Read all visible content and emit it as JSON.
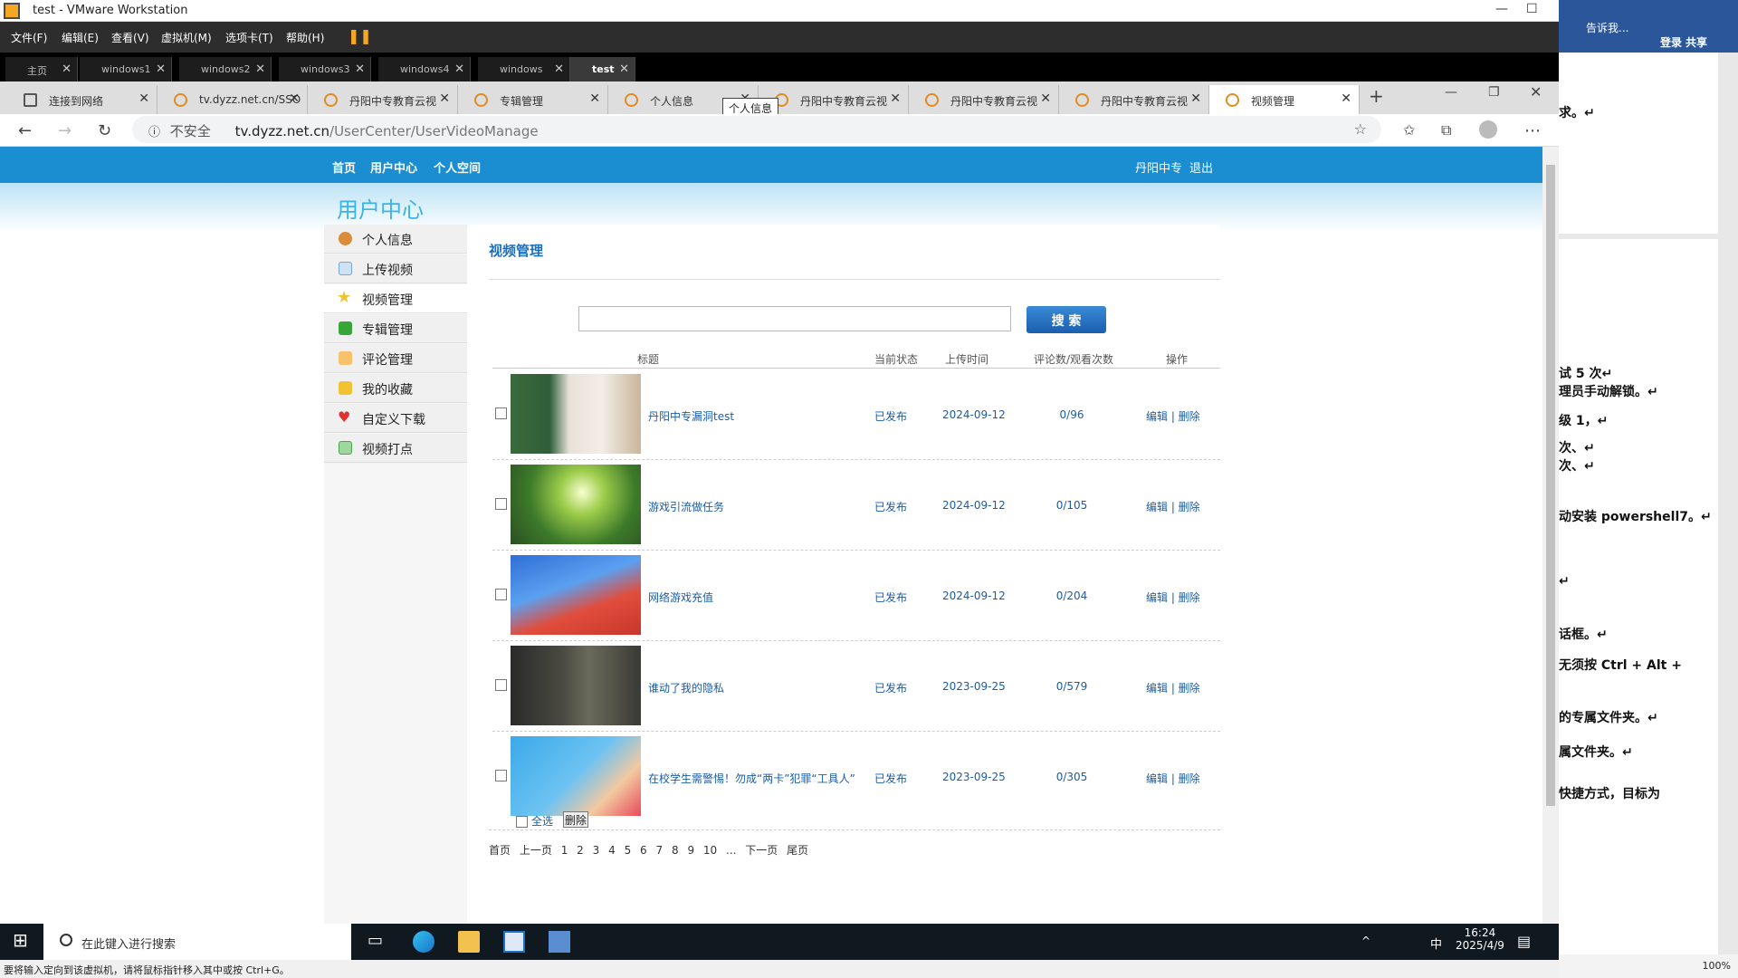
{
  "vmware": {
    "title": "test - VMware Workstation",
    "menu": [
      "文件(F)",
      "编辑(E)",
      "查看(V)",
      "虚拟机(M)",
      "选项卡(T)",
      "帮助(H)"
    ],
    "tabs": [
      "主页",
      "windows1",
      "windows2",
      "windows3",
      "windows4",
      "windows",
      "test"
    ]
  },
  "browser": {
    "tabs": [
      "连接到网络",
      "tv.dyzz.net.cn/SSO",
      "丹阳中专教育云视",
      "专辑管理",
      "个人信息",
      "丹阳中专教育云视",
      "丹阳中专教育云视",
      "丹阳中专教育云视",
      "视频管理"
    ],
    "tooltip": "个人信息",
    "not_secure": "不安全",
    "url_host": "tv.dyzz.net.cn",
    "url_path": "/UserCenter/UserVideoManage"
  },
  "site": {
    "nav": [
      "首页",
      "用户中心",
      "个人空间"
    ],
    "user": "丹阳中专",
    "logout": "退出",
    "header_title": "用户中心",
    "sidebar": [
      {
        "label": "个人信息",
        "color": "#d98c3a"
      },
      {
        "label": "上传视频",
        "color": "#6fa8dc"
      },
      {
        "label": "视频管理",
        "color": "#f1c232"
      },
      {
        "label": "专辑管理",
        "color": "#38a538"
      },
      {
        "label": "评论管理",
        "color": "#e6a23c"
      },
      {
        "label": "我的收藏",
        "color": "#7cbf3a"
      },
      {
        "label": "自定义下载",
        "color": "#e03030"
      },
      {
        "label": "视频打点",
        "color": "#4aa84a"
      }
    ],
    "main_title": "视频管理",
    "search_button": "搜 索",
    "columns": [
      "标题",
      "当前状态",
      "上传时间",
      "评论数/观看次数",
      "操作"
    ],
    "rows": [
      {
        "title": "丹阳中专漏洞test",
        "status": "已发布",
        "date": "2024-09-12",
        "count": "0/96",
        "ops": "编辑 | 删除"
      },
      {
        "title": "游戏引流做任务",
        "status": "已发布",
        "date": "2024-09-12",
        "count": "0/105",
        "ops": "编辑 | 删除"
      },
      {
        "title": "网络游戏充值",
        "status": "已发布",
        "date": "2024-09-12",
        "count": "0/204",
        "ops": "编辑 | 删除"
      },
      {
        "title": "谁动了我的隐私",
        "status": "已发布",
        "date": "2023-09-25",
        "count": "0/579",
        "ops": "编辑 | 删除"
      },
      {
        "title": "在校学生需警惕！勿成“两卡”犯罪“工具人”",
        "status": "已发布",
        "date": "2023-09-25",
        "count": "0/305",
        "ops": "编辑 | 删除"
      }
    ],
    "select_all": "全选",
    "delete_button": "删除",
    "pager": [
      "首页",
      "上一页",
      "1",
      "2",
      "3",
      "4",
      "5",
      "6",
      "7",
      "8",
      "9",
      "10",
      "...",
      "下一页",
      "尾页"
    ]
  },
  "taskbar": {
    "search_placeholder": "在此键入进行搜索",
    "time": "16:24",
    "date": "2025/4/9",
    "ime": "中"
  },
  "status_bar": "要将输入定向到该虚拟机，请将鼠标指针移入其中或按 Ctrl+G。",
  "word": {
    "tell_me": "告诉我...",
    "login": "登录",
    "share": "共享",
    "lines": [
      "求。↵",
      "试 5 次↵",
      "理员手动解锁。↵",
      "级 1，↵",
      "次、↵",
      "次、↵",
      "动安装 powershell7。↵",
      "↵",
      "话框。↵",
      "无须按 Ctrl + Alt +",
      "的专属文件夹。↵",
      "属文件夹。↵",
      "快捷方式，目标为"
    ],
    "zoom": "100%"
  }
}
